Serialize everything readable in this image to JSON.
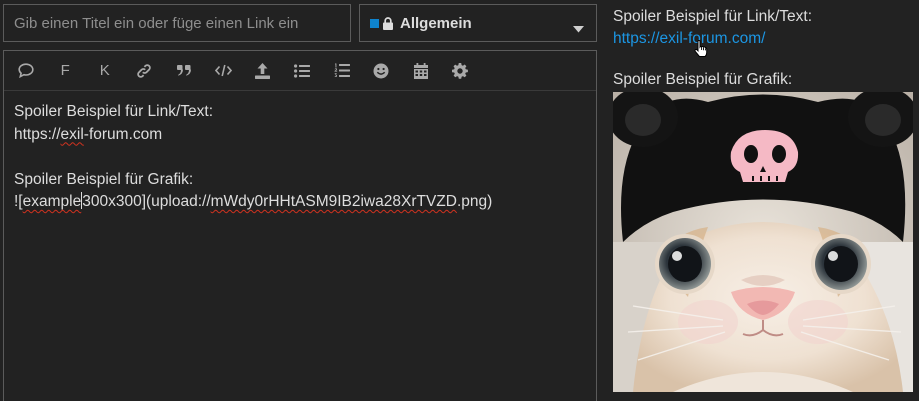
{
  "composer": {
    "title_placeholder": "Gib einen Titel ein oder füge einen Link ein",
    "category": {
      "label": "Allgemein",
      "color": "#0e83cd",
      "icons": [
        "square-icon",
        "lock-icon",
        "caret-down-icon"
      ]
    }
  },
  "toolbar": {
    "buttons": [
      {
        "name": "quote-icon"
      },
      {
        "name": "bold-button",
        "label": "F"
      },
      {
        "name": "italic-button",
        "label": "K"
      },
      {
        "name": "link-icon"
      },
      {
        "name": "blockquote-icon"
      },
      {
        "name": "code-icon"
      },
      {
        "name": "upload-icon"
      },
      {
        "name": "bullet-list-icon"
      },
      {
        "name": "numbered-list-icon"
      },
      {
        "name": "emoji-icon"
      },
      {
        "name": "calendar-icon"
      },
      {
        "name": "gear-icon"
      }
    ]
  },
  "editor": {
    "line1": "Spoiler Beispiel für Link/Text:",
    "line2_pre": "https://",
    "line2_squiggle": "exil",
    "line2_post": "-forum.com",
    "line4": "Spoiler Beispiel für Grafik:",
    "line5_a": "![",
    "line5_b": "example",
    "line5_c": "300x300](upload://",
    "line5_d": "mWdy0rHHtASM9IB2iwa28XrTVZD",
    "line5_e": ".png)"
  },
  "preview": {
    "heading1": "Spoiler Beispiel für Link/Text:",
    "link": "https://exil-forum.com/",
    "heading2": "Spoiler Beispiel für Grafik:",
    "image_name": "cat-in-black-hat-photo"
  },
  "colors": {
    "background": "#222222",
    "border": "#5b5b5b",
    "link": "#1c96e3",
    "spellcheck": "#d0321f"
  }
}
